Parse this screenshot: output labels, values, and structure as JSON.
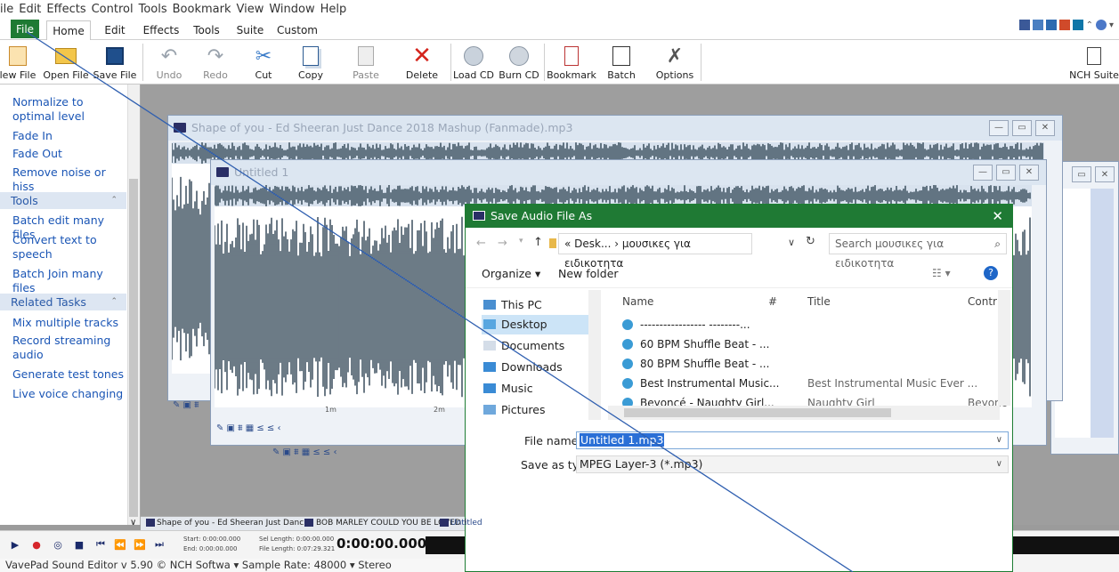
{
  "menubar": [
    "ile",
    "Edit",
    "Effects",
    "Control",
    "Tools",
    "Bookmark",
    "View",
    "Window",
    "Help"
  ],
  "tabs": [
    "File",
    "Home",
    "Edit",
    "Effects",
    "Tools",
    "Suite",
    "Custom"
  ],
  "ribbon": [
    {
      "label": "lew File",
      "icon": "new-file-icon"
    },
    {
      "label": "Open File",
      "icon": "open-file-icon"
    },
    {
      "label": "Save File",
      "icon": "save-icon"
    },
    {
      "label": "Undo",
      "icon": "undo-icon"
    },
    {
      "label": "Redo",
      "icon": "redo-icon"
    },
    {
      "label": "Cut",
      "icon": "cut-icon"
    },
    {
      "label": "Copy",
      "icon": "copy-icon"
    },
    {
      "label": "Paste",
      "icon": "paste-icon"
    },
    {
      "label": "Delete",
      "icon": "delete-icon"
    },
    {
      "label": "Load CD",
      "icon": "load-cd-icon"
    },
    {
      "label": "Burn CD",
      "icon": "burn-cd-icon"
    },
    {
      "label": "Bookmark",
      "icon": "bookmark-icon"
    },
    {
      "label": "Batch",
      "icon": "batch-icon"
    },
    {
      "label": "Options",
      "icon": "options-icon"
    },
    {
      "label": "NCH Suite",
      "icon": "nch-suite-icon"
    }
  ],
  "sidebar": {
    "effects_items": [
      "Normalize to optimal level",
      "Fade In",
      "Fade Out",
      "Remove noise or hiss"
    ],
    "tools_header": "Tools",
    "tools_items": [
      "Batch edit many files",
      "Convert text to speech",
      "Batch Join many files"
    ],
    "related_header": "Related Tasks",
    "related_items": [
      "Mix multiple tracks",
      "Record streaming audio",
      "Generate test tones",
      "Live voice changing"
    ]
  },
  "windows": {
    "win1_title": "Shape of you - Ed Sheeran  Just Dance 2018  Mashup (Fanmade).mp3",
    "win2_title": "Untitled 1",
    "timeline_ticks": [
      "1m",
      "2m"
    ]
  },
  "dialog": {
    "title": "Save Audio File As",
    "address": "« Desk... › μουσικες για ειδικοτητα",
    "search_placeholder": "Search μουσικες για ειδικοτητα",
    "organize": "Organize ▾",
    "new_folder": "New folder",
    "nav": [
      "This PC",
      "Desktop",
      "Documents",
      "Downloads",
      "Music",
      "Pictures"
    ],
    "columns": {
      "name": "Name",
      "num": "#",
      "title": "Title",
      "contrib": "Contrib"
    },
    "files": [
      {
        "name": "----------------- --------...",
        "title": "",
        "contrib": ""
      },
      {
        "name": "60 BPM Shuffle Beat - ...",
        "title": "",
        "contrib": ""
      },
      {
        "name": "80 BPM Shuffle Beat - ...",
        "title": "",
        "contrib": ""
      },
      {
        "name": "Best Instrumental Music...",
        "title": "Best Instrumental Music Ever ...",
        "contrib": ""
      },
      {
        "name": "Beyoncé - Naughty Girl...",
        "title": "Naughty Girl",
        "contrib": "Beyonc"
      }
    ],
    "filename_label": "File name:",
    "filename_value": "Untitled 1.mp3",
    "type_label": "Save as type:",
    "type_value": "MPEG Layer-3 (*.mp3)"
  },
  "bottom": {
    "tabs": [
      "Shape of you - Ed Sheeran  Just Danc",
      "BOB MARLEY COULD YOU BE LOVED !",
      "Untitled"
    ],
    "start": "Start: 0:00:00.000",
    "end": "End:  0:00:00.000",
    "sel_length": "Sel Length: 0:00:00.000",
    "file_length": "File Length: 0:07:29.321",
    "time": "0:00:00.000",
    "status": "VavePad Sound Editor v 5.90 © NCH Softwa  ▾ Sample Rate: 48000  ▾ Stereo"
  }
}
